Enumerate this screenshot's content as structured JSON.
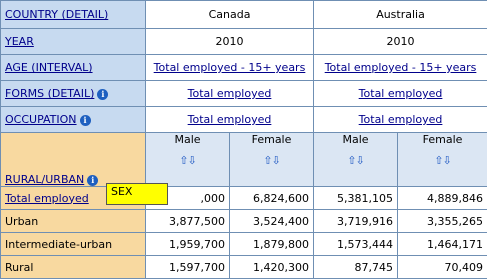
{
  "dims": {
    "country": {
      "label": "COUNTRY (DETAIL)",
      "values": [
        "Canada",
        "Australia"
      ]
    },
    "year": {
      "label": "YEAR",
      "values": [
        "2010",
        "2010"
      ]
    },
    "age": {
      "label": "AGE (INTERVAL)",
      "values": [
        "Total employed - 15+ years",
        "Total employed - 15+ years"
      ]
    },
    "forms": {
      "label": "FORMS (DETAIL)",
      "values": [
        "Total employed",
        "Total employed"
      ]
    },
    "occupation": {
      "label": "OCCUPATION",
      "values": [
        "Total employed",
        "Total employed"
      ]
    }
  },
  "sex_headers": [
    "Male",
    "Female",
    "Male",
    "Female"
  ],
  "sort_glyph": "⇧⇩",
  "row_dim": "RURAL/URBAN",
  "tooltip": "SEX",
  "rows": [
    {
      "label": "Total employed",
      "link": true,
      "values": [
        ",000",
        "6,824,600",
        "5,381,105",
        "4,889,846"
      ]
    },
    {
      "label": "Urban",
      "link": false,
      "values": [
        "3,877,500",
        "3,524,400",
        "3,719,916",
        "3,355,265"
      ]
    },
    {
      "label": "Intermediate-urban",
      "link": false,
      "values": [
        "1,959,700",
        "1,879,800",
        "1,573,444",
        "1,464,171"
      ]
    },
    {
      "label": "Rural",
      "link": false,
      "values": [
        "1,597,700",
        "1,420,300",
        "87,745",
        "70,409"
      ]
    }
  ],
  "colors": {
    "header_bg": "#c7daf0",
    "row_label_bg": "#f8d9a0",
    "tooltip_bg": "#ffff00",
    "border": "#6f8fb3"
  }
}
